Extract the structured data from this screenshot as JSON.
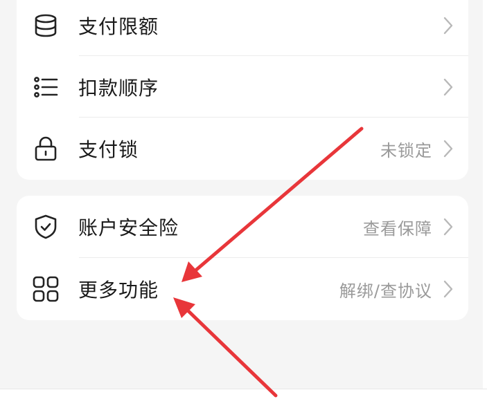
{
  "colors": {
    "background": "#f5f5f5",
    "card": "#ffffff",
    "label": "#1a1a1a",
    "value": "#9a9a9a",
    "chevron": "#b8b8b8",
    "icon": "#222222",
    "annotation_arrow": "#e8363a"
  },
  "card1": {
    "items": [
      {
        "label": "支付限额",
        "value": "",
        "icon": "database-icon"
      },
      {
        "label": "扣款顺序",
        "value": "",
        "icon": "list-icon"
      },
      {
        "label": "支付锁",
        "value": "未锁定",
        "icon": "lock-icon"
      }
    ]
  },
  "card2": {
    "items": [
      {
        "label": "账户安全险",
        "value": "查看保障",
        "icon": "shield-check-icon"
      },
      {
        "label": "更多功能",
        "value": "解绑/查协议",
        "icon": "grid-icon"
      }
    ]
  },
  "annotation": {
    "arrows": "two-red-arrows-pointing-at-more-functions"
  }
}
